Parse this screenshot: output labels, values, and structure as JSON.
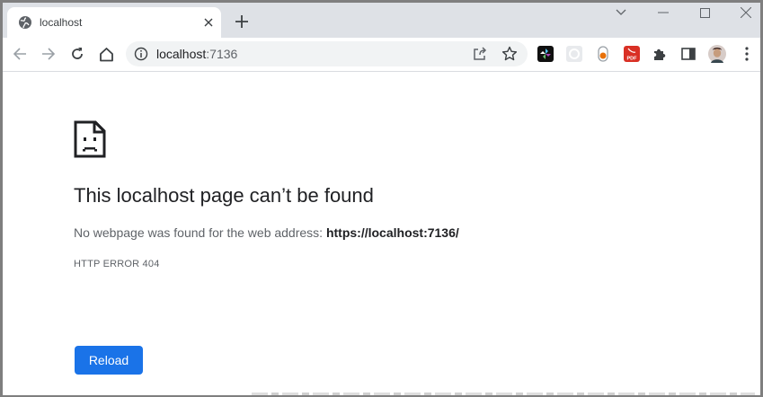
{
  "browser": {
    "tab": {
      "title": "localhost",
      "favicon": "globe-icon"
    },
    "new_tab_icon": "plus-icon",
    "window_controls": [
      "chevron-down-icon",
      "minimize-icon",
      "maximize-icon",
      "close-icon"
    ],
    "address_bar": {
      "host": "localhost",
      "port": ":7136",
      "info_icon": "info-icon"
    },
    "nav_icons": [
      "back-arrow-icon",
      "forward-arrow-icon",
      "reload-icon",
      "home-icon"
    ],
    "extensions": [
      "pinwheel-extension-icon",
      "grid-extension-icon",
      "toggle-extension-icon",
      "pdf-extension-icon"
    ],
    "pdf_badge": "PDF"
  },
  "error_page": {
    "heading": "This localhost page can’t be found",
    "description_prefix": "No webpage was found for the web address: ",
    "url": "https://localhost:7136/",
    "error_code": "HTTP ERROR 404",
    "reload_label": "Reload"
  },
  "colors": {
    "accent": "#1a73e8",
    "tabstrip": "#dee1e6",
    "omnibox": "#f1f3f4"
  }
}
